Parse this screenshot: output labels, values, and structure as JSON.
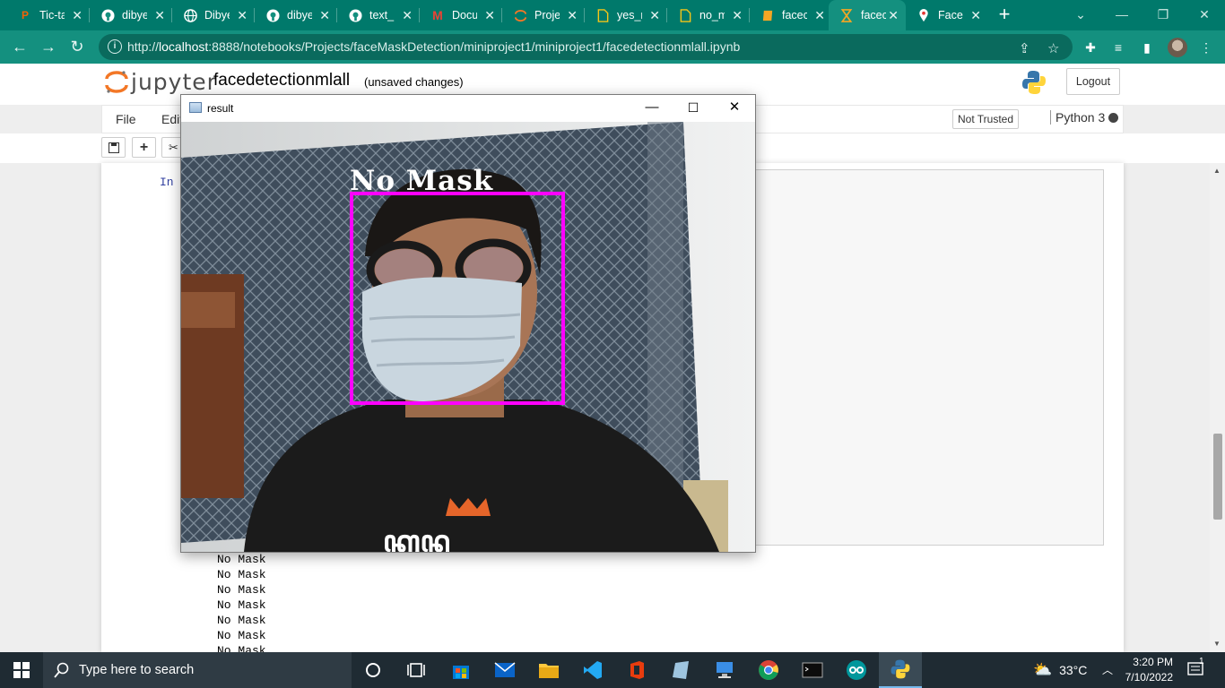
{
  "browser": {
    "tabs": [
      {
        "label": "Tic-ta",
        "icon": "replit-icon",
        "active": false
      },
      {
        "label": "dibye",
        "icon": "github-icon",
        "active": false
      },
      {
        "label": "Dibye",
        "icon": "globe-icon",
        "active": false
      },
      {
        "label": "dibye",
        "icon": "github-icon",
        "active": false
      },
      {
        "label": "text_",
        "icon": "github-icon",
        "active": false
      },
      {
        "label": "Docu",
        "icon": "gmail-icon",
        "active": false
      },
      {
        "label": "Proje",
        "icon": "jupyter-icon",
        "active": false
      },
      {
        "label": "yes_m",
        "icon": "file-icon",
        "active": false
      },
      {
        "label": "no_m",
        "icon": "file-icon",
        "active": false
      },
      {
        "label": "facec",
        "icon": "notebook-icon",
        "active": false
      },
      {
        "label": "facec",
        "icon": "hourglass-icon",
        "active": true
      },
      {
        "label": "Face",
        "icon": "pin-icon",
        "active": false
      }
    ],
    "url_prefix": "http://",
    "url_host": "localhost",
    "url_rest": ":8888/notebooks/Projects/faceMaskDetection/miniproject1/miniproject1/facedetectionmlall.ipynb"
  },
  "jupyter": {
    "logo_text": "jupyter",
    "notebook_title": "facedetectionmlall",
    "save_status": "(unsaved changes)",
    "logout_label": "Logout",
    "menu": [
      "File",
      "Edit"
    ],
    "trust_label": "Not Trusted",
    "kernel_label": "Python 3",
    "cell_prompt": "In",
    "output_lines": [
      "No Mask",
      "No Mask",
      "No Mask",
      "No Mask",
      "No Mask",
      "No Mask",
      "No Mask"
    ]
  },
  "result_window": {
    "title": "result",
    "detection_label": "No Mask",
    "box_color": "#ff00ff"
  },
  "taskbar": {
    "search_placeholder": "Type here to search",
    "temperature": "33°C",
    "time": "3:20 PM",
    "date": "7/10/2022",
    "notification_count": "1"
  },
  "colors": {
    "chrome_accent": "#00796b",
    "taskbar": "#1f2b33"
  }
}
